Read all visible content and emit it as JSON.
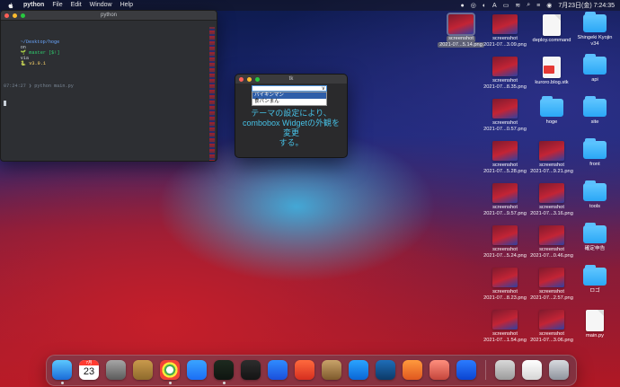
{
  "menubar": {
    "app": "python",
    "items": [
      "File",
      "Edit",
      "Window",
      "Help"
    ],
    "datetime": "7月23日(金) 7:24:35"
  },
  "terminal": {
    "title": "python",
    "line1": {
      "path": "~/Desktop/hoge",
      "on": "on",
      "branch": "🌱 master [$!]",
      "via": "via",
      "python": "🐍 v3.9.1"
    },
    "line2": "07:24:27 ❯ python main.py",
    "cursor": "▌"
  },
  "tk_window": {
    "title": "tk",
    "combobox_value": "",
    "combobox_arrow": "∨",
    "options": [
      "バイキンマン",
      "食パンまん"
    ],
    "selected_index": 0,
    "message_line1": "テーマの設定により、",
    "message_line2": "combobox Widgetの外観を変更",
    "message_line3": "する。"
  },
  "desktop": {
    "selected_screenshot": {
      "line1": "screenshot",
      "line2": "2021-07...5.14.png"
    },
    "col1": [
      {
        "name": "screenshot",
        "sub": "2021-07...3.09.png"
      },
      {
        "name": "screenshot",
        "sub": "2021-07...8.35.png"
      },
      {
        "name": "screenshot",
        "sub": "2021-07...0.57.png"
      },
      {
        "name": "screenshot",
        "sub": "2021-07...5.28.png"
      },
      {
        "name": "screenshot",
        "sub": "2021-07...9.57.png"
      },
      {
        "name": "screenshot",
        "sub": "2021-07...5.24.png"
      },
      {
        "name": "screenshot",
        "sub": "2021-07...8.23.png"
      },
      {
        "name": "screenshot",
        "sub": "2021-07...1.54.png"
      }
    ],
    "col2": [
      {
        "name": "deploy.command",
        "sub": ""
      },
      {
        "name": "kuroro.blog.stk",
        "sub": ""
      },
      {
        "name": "hoge",
        "sub": ""
      },
      {
        "name": "screenshot",
        "sub": "2021-07...9.21.png"
      },
      {
        "name": "screenshot",
        "sub": "2021-07...3.16.png"
      },
      {
        "name": "screenshot",
        "sub": "2021-07...0.46.png"
      },
      {
        "name": "screenshot",
        "sub": "2021-07...2.57.png"
      },
      {
        "name": "screenshot",
        "sub": "2021-07...3.06.png"
      }
    ],
    "col3": [
      {
        "name": "Shingeki Kyojin",
        "sub": "v34"
      },
      {
        "name": "api",
        "sub": ""
      },
      {
        "name": "site",
        "sub": ""
      },
      {
        "name": "front",
        "sub": ""
      },
      {
        "name": "tools",
        "sub": ""
      },
      {
        "name": "確定申告",
        "sub": ""
      },
      {
        "name": "ロゴ",
        "sub": ""
      },
      {
        "name": "main.py",
        "sub": ""
      }
    ]
  },
  "dock": {
    "calendar_month": "7月",
    "calendar_day": "23"
  }
}
